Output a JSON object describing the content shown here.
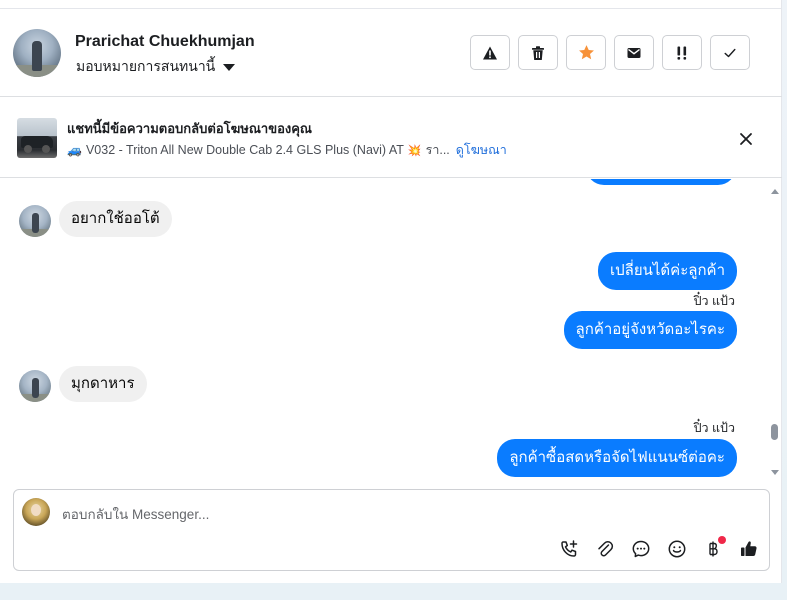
{
  "header": {
    "contact_name": "Prarichat Chuekhumjan",
    "assign_label": "มอบหมายการสนทนานี้",
    "actions": [
      {
        "name": "spam-button",
        "icon": "warning-triangle-icon"
      },
      {
        "name": "delete-button",
        "icon": "trash-icon"
      },
      {
        "name": "star-button",
        "icon": "star-icon",
        "color": "#f7923a"
      },
      {
        "name": "mark-unread-button",
        "icon": "envelope-icon"
      },
      {
        "name": "follow-up-button",
        "icon": "double-exclamation-icon"
      },
      {
        "name": "mark-done-button",
        "icon": "checkmark-icon"
      }
    ]
  },
  "ad_banner": {
    "title": "แชทนี้มีข้อความตอบกลับต่อโฆษณาของคุณ",
    "truck_emoji": "🚙",
    "subtitle": "V032 - Triton All New Double Cab 2.4 GLS Plus (Navi) AT",
    "spark_emoji": "💥",
    "subtitle_tail": "รา...",
    "link_label": "ดูโฆษณา"
  },
  "messages": [
    {
      "from": "contact",
      "text": "อยากใช้ออโต้"
    },
    {
      "from": "page",
      "text": "เปลี่ยนได้ค่ะลูกค้า"
    },
    {
      "from": "page",
      "seen": "ปิ๋ว แป้ว",
      "text": "ลูกค้าอยู่จังหวัดอะไรคะ"
    },
    {
      "from": "contact",
      "text": "มุกดาหาร"
    },
    {
      "from": "page",
      "seen": "ปิ๋ว แป้ว",
      "text": "ลูกค้าซื้อสดหรือจัดไฟแนนซ์ต่อคะ"
    }
  ],
  "composer": {
    "placeholder": "ตอบกลับใน Messenger...",
    "tools": [
      "call-add-icon",
      "paperclip-icon",
      "chat-bubble-icon",
      "smiley-icon",
      "baht-icon",
      "thumbs-up-icon"
    ]
  },
  "colors": {
    "outgoing_bubble": "#0a7cff",
    "incoming_bubble": "#f0f0f0",
    "star_accent": "#f7923a",
    "link": "#216fdb"
  }
}
